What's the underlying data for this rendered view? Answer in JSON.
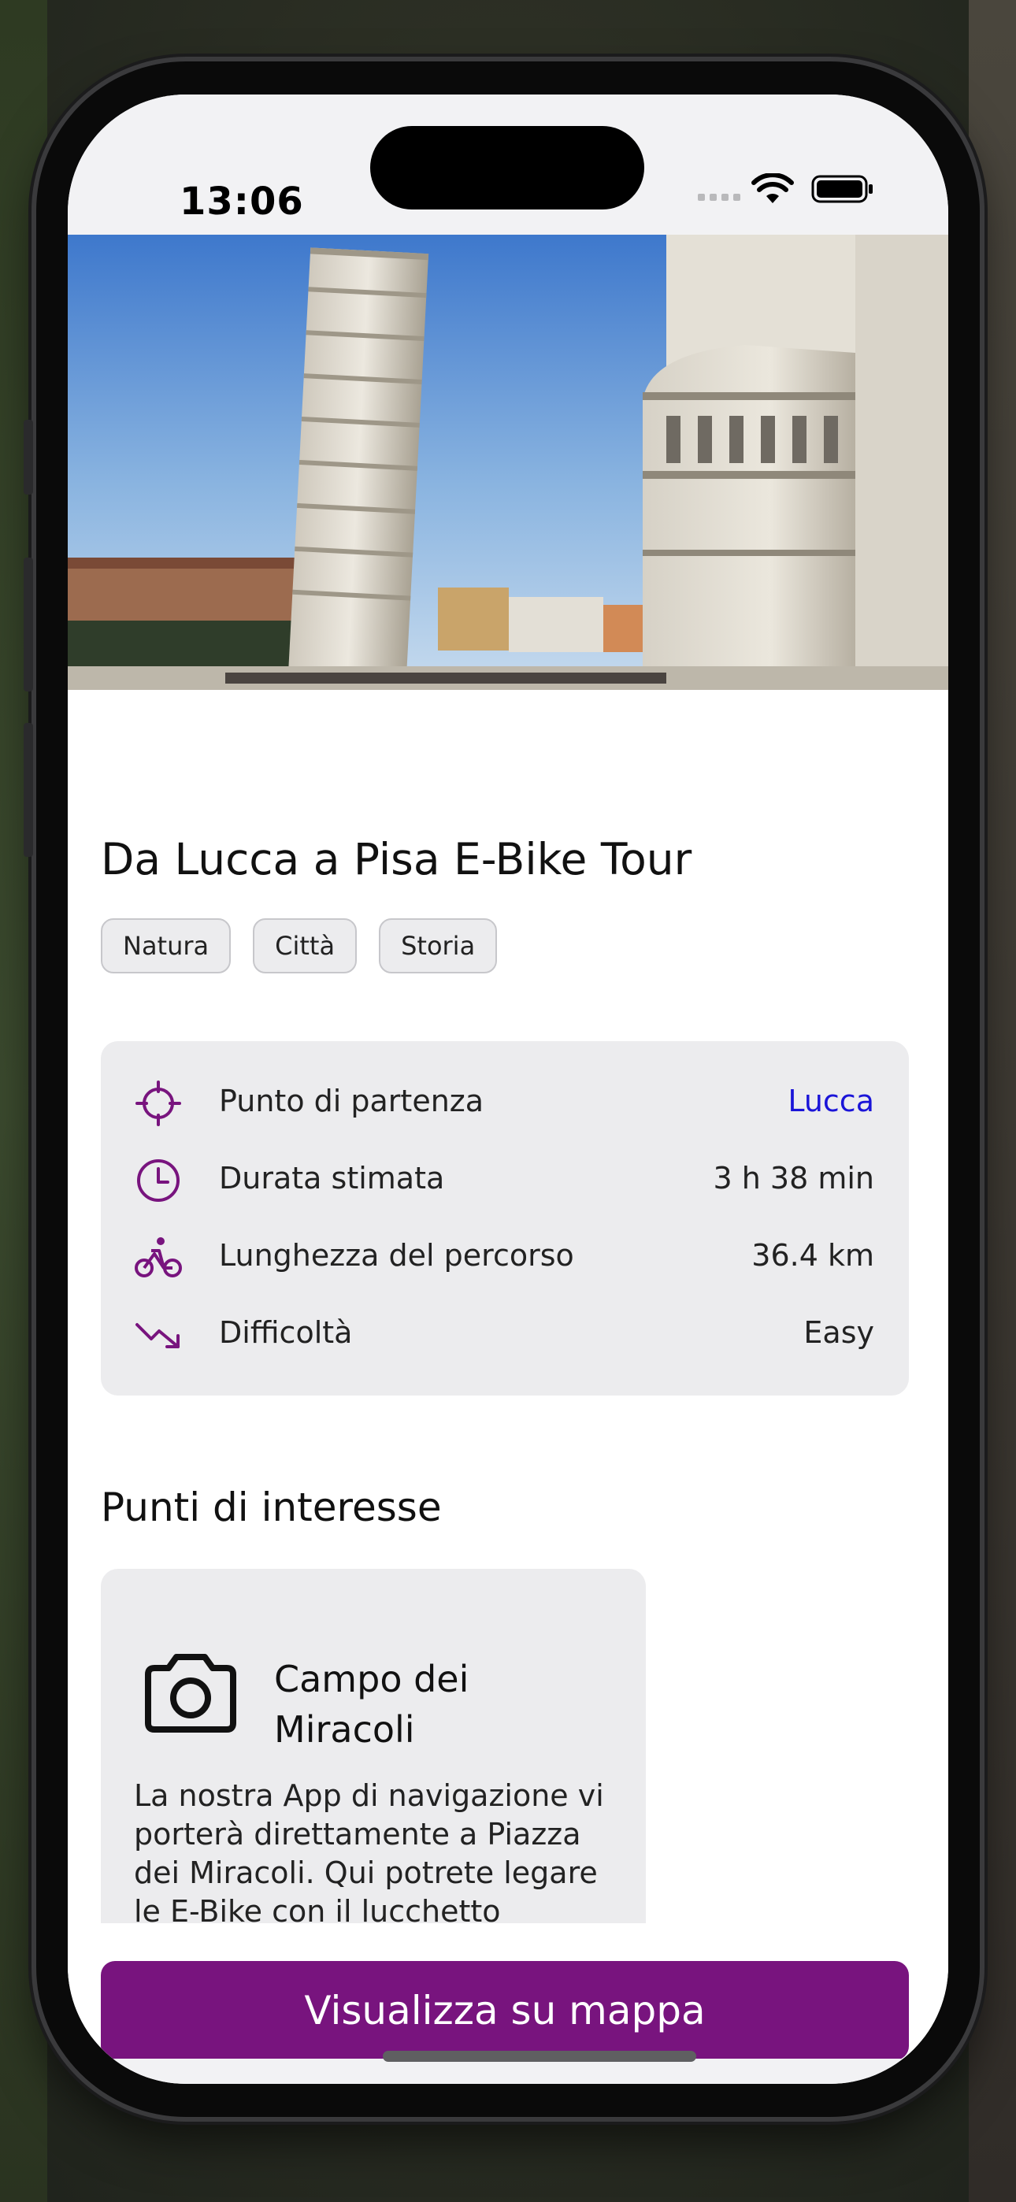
{
  "status_bar": {
    "time": "13:06"
  },
  "hero": {
    "alt": "Torre pendente di Pisa e Duomo"
  },
  "tour": {
    "title": "Da Lucca a Pisa E-Bike Tour",
    "tags": [
      "Natura",
      "Città",
      "Storia"
    ]
  },
  "info": {
    "rows": [
      {
        "icon": "crosshair-icon",
        "label": "Punto di partenza",
        "value": "Lucca",
        "is_link": true
      },
      {
        "icon": "clock-icon",
        "label": "Durata stimata",
        "value": "3 h 38 min",
        "is_link": false
      },
      {
        "icon": "bike-icon",
        "label": "Lunghezza del percorso",
        "value": "36.4 km",
        "is_link": false
      },
      {
        "icon": "trend-down-icon",
        "label": "Difficoltà",
        "value": "Easy",
        "is_link": false
      }
    ]
  },
  "poi_section": {
    "title": "Punti di interesse",
    "items": [
      {
        "icon": "camera-icon",
        "name": "Campo dei Miracoli",
        "description": "La nostra App di navigazione vi porterà direttamente a Piazza dei Miracoli. Qui potrete legare le E-Bike con il lucchetto"
      }
    ]
  },
  "actions": {
    "map_button": "Visualizza su mappa"
  },
  "colors": {
    "accent": "#78147E",
    "link": "#1A14D8",
    "card_bg": "#ECECEE"
  }
}
